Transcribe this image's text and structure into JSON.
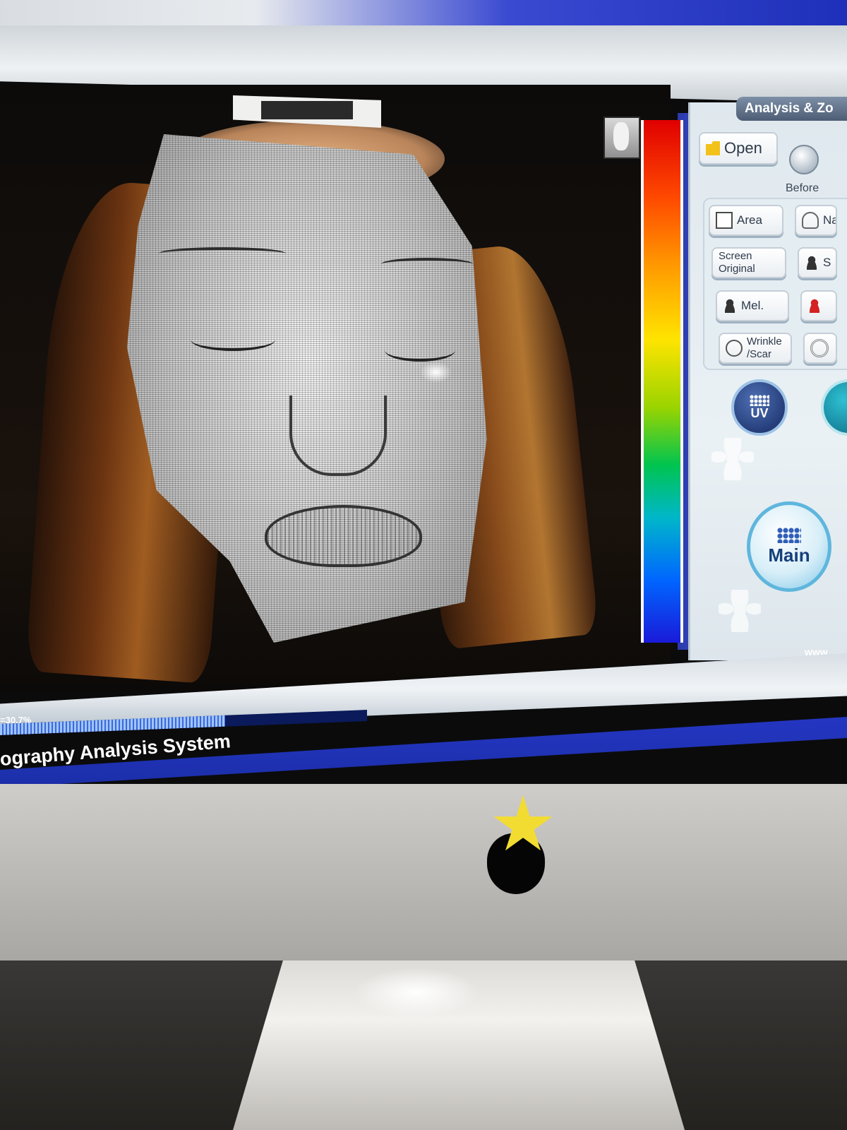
{
  "app": {
    "panel_title": "Analysis & Zo",
    "footer_title": "ography Analysis System",
    "url_fragment": "www"
  },
  "toolbar": {
    "open_label": "Open",
    "before_label": "Before"
  },
  "analysis_buttons": [
    {
      "label": "Area",
      "icon": "square-icon"
    },
    {
      "label": "Na",
      "icon": "outline-person-icon"
    },
    {
      "label": "Screen\nOriginal",
      "icon": ""
    },
    {
      "label": "S",
      "icon": "person-icon"
    },
    {
      "label": "Mel.",
      "icon": "person-icon"
    },
    {
      "label": "",
      "icon": "red-person-icon"
    },
    {
      "label": "Wrinkle\n/Scar",
      "icon": "swirl-icon"
    },
    {
      "label": "",
      "icon": "ring-icon"
    }
  ],
  "mode_buttons": {
    "uv_label": "UV",
    "main_label": "Main"
  },
  "progress": {
    "label": "=30.7%",
    "value": 0.307
  },
  "colors": {
    "title_bar_blue": "#1e2fb9",
    "accent_blue": "#2436c2",
    "main_button_ring": "#5fb6dd",
    "sticker_yellow": "#f3dc31"
  }
}
